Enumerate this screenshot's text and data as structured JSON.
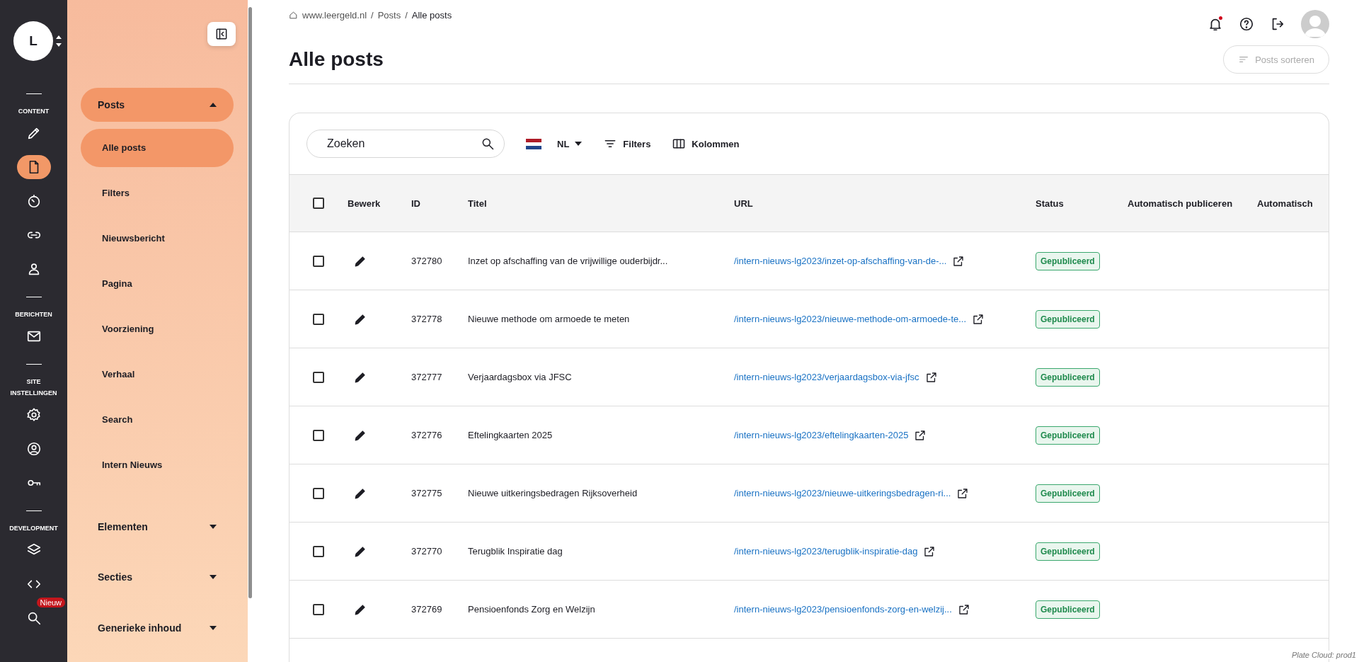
{
  "rail": {
    "logo": "L",
    "sections": [
      {
        "label": "CONTENT",
        "items": [
          {
            "kind": "pencil",
            "selected": false
          },
          {
            "kind": "document",
            "selected": true
          },
          {
            "kind": "timer",
            "selected": false
          },
          {
            "kind": "link",
            "selected": false
          },
          {
            "kind": "person",
            "selected": false
          }
        ]
      },
      {
        "label": "BERICHTEN",
        "items": [
          {
            "kind": "mail",
            "selected": false
          }
        ]
      },
      {
        "label": "SITE INSTELLINGEN",
        "items": [
          {
            "kind": "gear",
            "selected": false
          },
          {
            "kind": "account",
            "selected": false
          },
          {
            "kind": "key",
            "selected": false
          }
        ]
      },
      {
        "label": "DEVELOPMENT",
        "items": [
          {
            "kind": "layers",
            "selected": false
          },
          {
            "kind": "code",
            "selected": false
          },
          {
            "kind": "search",
            "selected": false,
            "badge": "Nieuw"
          }
        ]
      }
    ]
  },
  "sidebar": {
    "groups": [
      {
        "label": "Posts",
        "expanded": true,
        "children": [
          {
            "label": "Alle posts",
            "selected": true
          },
          {
            "label": "Filters",
            "selected": false
          },
          {
            "label": "Nieuwsbericht",
            "selected": false
          },
          {
            "label": "Pagina",
            "selected": false
          },
          {
            "label": "Voorziening",
            "selected": false
          },
          {
            "label": "Verhaal",
            "selected": false
          },
          {
            "label": "Search",
            "selected": false
          },
          {
            "label": "Intern Nieuws",
            "selected": false
          }
        ]
      },
      {
        "label": "Elementen",
        "expanded": false
      },
      {
        "label": "Secties",
        "expanded": false
      },
      {
        "label": "Generieke inhoud",
        "expanded": false
      }
    ]
  },
  "breadcrumb": {
    "separator": "/",
    "items": [
      "www.leergeld.nl",
      "Posts",
      "Alle posts"
    ]
  },
  "page_title": "Alle posts",
  "sort_button": {
    "label": "Posts sorteren",
    "disabled": true
  },
  "notifications": {
    "unread": true
  },
  "toolbar": {
    "search": {
      "placeholder": "Zoeken"
    },
    "language": "NL",
    "filters": "Filters",
    "columns": "Kolommen"
  },
  "table": {
    "all_checked": false,
    "columns": [
      "Bewerk",
      "ID",
      "Titel",
      "URL",
      "Status",
      "Automatisch publiceren",
      "Automatisch"
    ],
    "rows": [
      {
        "checked": false,
        "id": "372780",
        "title": "Inzet op afschaffing van de vrijwillige ouderbijdr...",
        "url": "/intern-nieuws-lg2023/inzet-op-afschaffing-van-de-...",
        "status": "Gepubliceerd"
      },
      {
        "checked": false,
        "id": "372778",
        "title": "Nieuwe methode om armoede te meten",
        "url": "/intern-nieuws-lg2023/nieuwe-methode-om-armoede-te...",
        "status": "Gepubliceerd"
      },
      {
        "checked": false,
        "id": "372777",
        "title": "Verjaardagsbox via JFSC",
        "url": "/intern-nieuws-lg2023/verjaardagsbox-via-jfsc",
        "status": "Gepubliceerd"
      },
      {
        "checked": false,
        "id": "372776",
        "title": "Eftelingkaarten 2025",
        "url": "/intern-nieuws-lg2023/eftelingkaarten-2025",
        "status": "Gepubliceerd"
      },
      {
        "checked": false,
        "id": "372775",
        "title": "Nieuwe uitkeringsbedragen Rijksoverheid",
        "url": "/intern-nieuws-lg2023/nieuwe-uitkeringsbedragen-ri...",
        "status": "Gepubliceerd"
      },
      {
        "checked": false,
        "id": "372770",
        "title": "Terugblik Inspiratie dag",
        "url": "/intern-nieuws-lg2023/terugblik-inspiratie-dag",
        "status": "Gepubliceerd"
      },
      {
        "checked": false,
        "id": "372769",
        "title": "Pensioenfonds Zorg en Welzijn",
        "url": "/intern-nieuws-lg2023/pensioenfonds-zorg-en-welzij...",
        "status": "Gepubliceerd"
      }
    ]
  },
  "footer_note": "Plate Cloud: prod1"
}
